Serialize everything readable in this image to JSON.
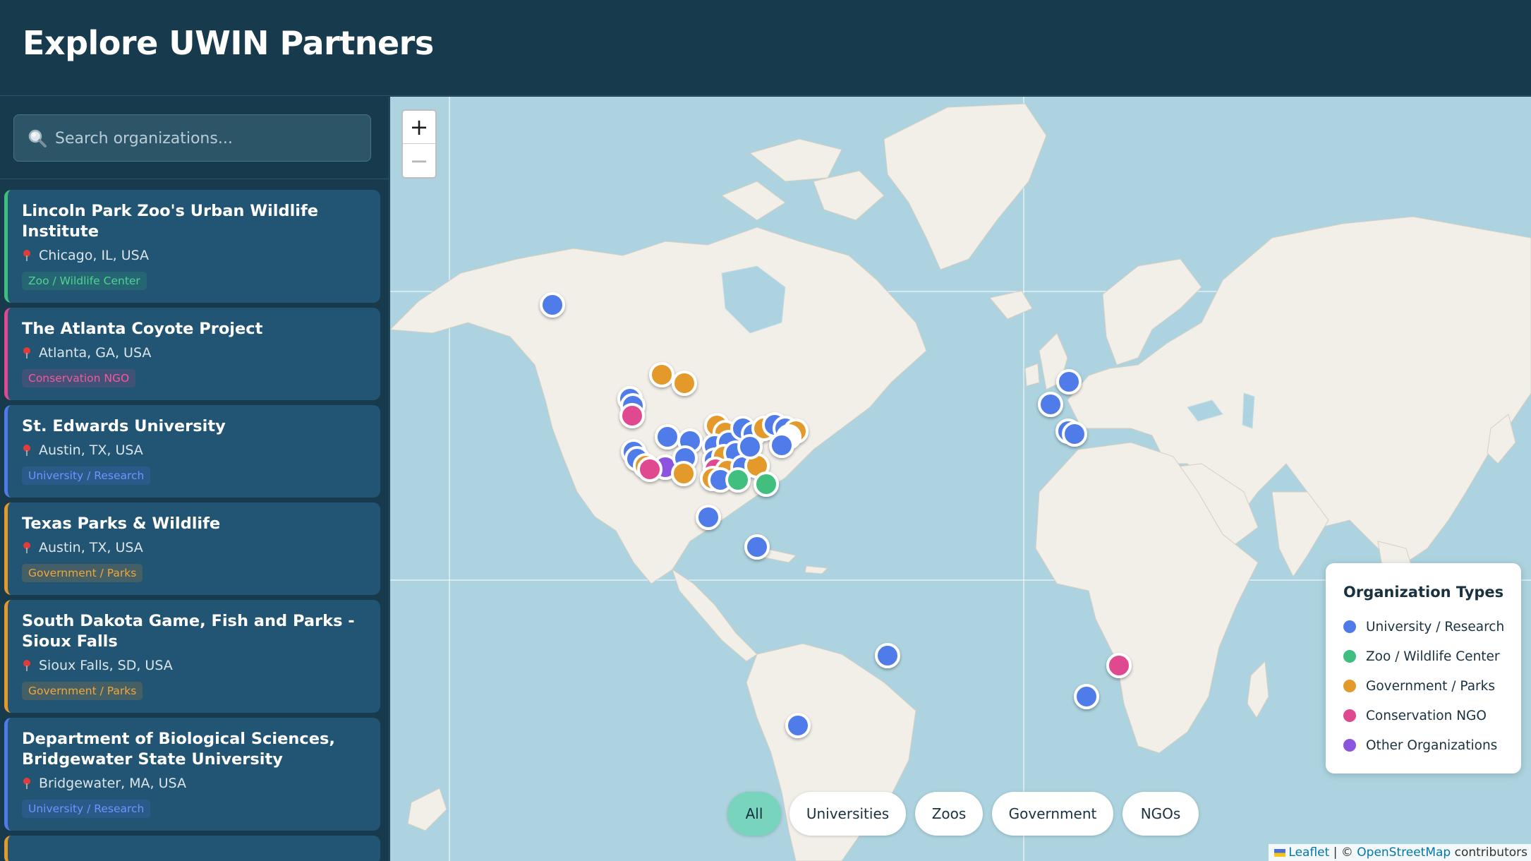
{
  "header": {
    "title": "Explore UWIN Partners"
  },
  "search": {
    "placeholder": "Search organizations...",
    "icon": "magnifier-icon",
    "value": ""
  },
  "type_colors": {
    "university": "#4f7be8",
    "zoo": "#3fbf7f",
    "government": "#e39a2b",
    "ngo": "#e0488f",
    "other": "#8b55e0"
  },
  "organizations": [
    {
      "name": "Lincoln Park Zoo's Urban Wildlife Institute",
      "location": "Chicago, IL, USA",
      "type": "Zoo / Wildlife Center"
    },
    {
      "name": "The Atlanta Coyote Project",
      "location": "Atlanta, GA, USA",
      "type": "Conservation NGO"
    },
    {
      "name": "St. Edwards University",
      "location": "Austin, TX, USA",
      "type": "University / Research"
    },
    {
      "name": "Texas Parks & Wildlife",
      "location": "Austin, TX, USA",
      "type": "Government / Parks"
    },
    {
      "name": "South Dakota Game, Fish and Parks - Sioux Falls",
      "location": "Sioux Falls, SD, USA",
      "type": "Government / Parks"
    },
    {
      "name": "Department of Biological Sciences, Bridgewater State University",
      "location": "Bridgewater, MA, USA",
      "type": "University / Research"
    }
  ],
  "map": {
    "zoom_in_label": "+",
    "zoom_out_label": "−",
    "legend": {
      "title": "Organization Types",
      "items": [
        {
          "label": "University / Research",
          "color": "#4f7be8"
        },
        {
          "label": "Zoo / Wildlife Center",
          "color": "#3fbf7f"
        },
        {
          "label": "Government / Parks",
          "color": "#e39a2b"
        },
        {
          "label": "Conservation NGO",
          "color": "#e0488f"
        },
        {
          "label": "Other Organizations",
          "color": "#8b55e0"
        }
      ]
    },
    "filters": [
      {
        "label": "All",
        "active": true
      },
      {
        "label": "Universities",
        "active": false
      },
      {
        "label": "Zoos",
        "active": false
      },
      {
        "label": "Government",
        "active": false
      },
      {
        "label": "NGOs",
        "active": false
      }
    ],
    "attribution": {
      "leaflet": "Leaflet",
      "separator": "| ©",
      "osm": "OpenStreetMap",
      "suffix": "contributors"
    }
  }
}
